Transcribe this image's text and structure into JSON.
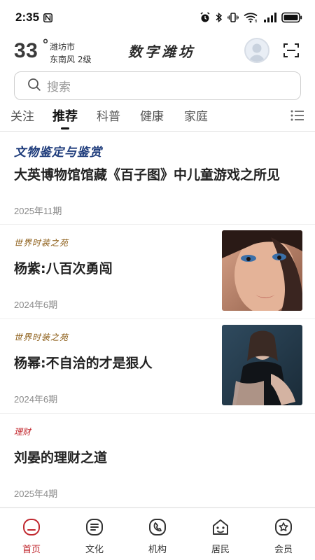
{
  "status_bar": {
    "time": "2:35",
    "icons": [
      "n-icon",
      "alarm-icon",
      "bluetooth-icon",
      "vibrate-icon",
      "wifi-icon",
      "signal-icon",
      "battery-icon"
    ]
  },
  "header": {
    "temperature": "33",
    "degree_symbol": "°",
    "city": "潍坊市",
    "wind": "东南风  2级",
    "app_title": "数字潍坊"
  },
  "search": {
    "placeholder": "搜索"
  },
  "tabs": [
    {
      "label": "关注",
      "active": false
    },
    {
      "label": "推荐",
      "active": true
    },
    {
      "label": "科普",
      "active": false
    },
    {
      "label": "健康",
      "active": false
    },
    {
      "label": "家庭",
      "active": false
    }
  ],
  "feed": [
    {
      "source": "文物鉴定与鉴赏",
      "title": "大英博物馆馆藏《百子图》中儿童游戏之所见",
      "issue": "2025年11期"
    },
    {
      "source": "世界时装之苑",
      "title": "杨紫:八百次勇闯",
      "issue": "2024年6期",
      "thumbnail": "portrait-photo"
    },
    {
      "source": "世界时装之苑",
      "title": "杨幂:不自洽的才是狠人",
      "issue": "2024年6期",
      "thumbnail": "portrait-photo"
    },
    {
      "source": "理财",
      "title": "刘晏的理财之道",
      "issue": "2025年4期"
    }
  ],
  "bottom_nav": [
    {
      "label": "首页",
      "icon": "home-icon",
      "active": true
    },
    {
      "label": "文化",
      "icon": "culture-icon",
      "active": false
    },
    {
      "label": "机构",
      "icon": "organization-icon",
      "active": false
    },
    {
      "label": "居民",
      "icon": "resident-icon",
      "active": false
    },
    {
      "label": "会员",
      "icon": "member-icon",
      "active": false
    }
  ],
  "colors": {
    "accent": "#c0282f",
    "source_blue": "#1c3a7a",
    "source_gold": "#8a5a12"
  }
}
